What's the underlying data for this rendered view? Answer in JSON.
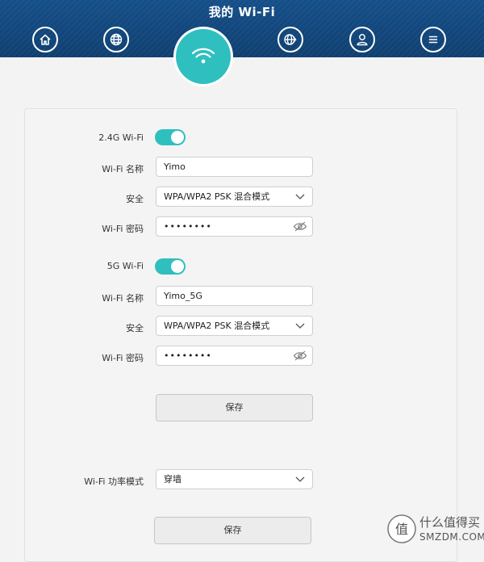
{
  "header": {
    "title": "我的 Wi-Fi",
    "nav": [
      {
        "icon": "home-icon"
      },
      {
        "icon": "globe-icon"
      },
      {
        "icon": "wifi-icon",
        "active": true
      },
      {
        "icon": "network-globe-icon"
      },
      {
        "icon": "user-icon"
      },
      {
        "icon": "menu-icon"
      }
    ],
    "accent_color": "#2fbfbf",
    "bar_color": "#12467a"
  },
  "wifi24": {
    "toggle_label": "2.4G Wi-Fi",
    "enabled": true,
    "name_label": "Wi-Fi 名称",
    "name_value": "Yimo",
    "security_label": "安全",
    "security_value": "WPA/WPA2 PSK 混合模式",
    "password_label": "Wi-Fi 密码",
    "password_value": "••••••••"
  },
  "wifi5": {
    "toggle_label": "5G Wi-Fi",
    "enabled": true,
    "name_label": "Wi-Fi 名称",
    "name_value": "Yimo_5G",
    "security_label": "安全",
    "security_value": "WPA/WPA2 PSK 混合模式",
    "password_label": "Wi-Fi 密码",
    "password_value": "••••••••"
  },
  "save_label": "保存",
  "power": {
    "label": "Wi-Fi 功率模式",
    "value": "穿墙"
  },
  "save_label_2": "保存",
  "watermark": {
    "line1": "什么值得买",
    "line2": "SMZDM.COM"
  }
}
